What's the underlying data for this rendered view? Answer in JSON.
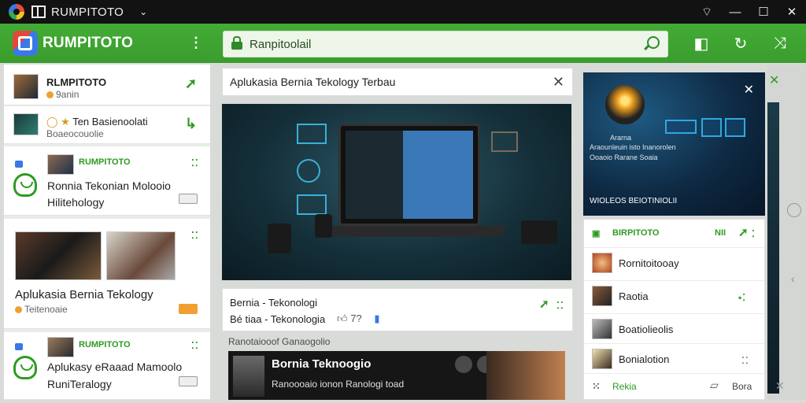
{
  "window": {
    "title": "RUMPITOTO",
    "chevron": "⌄",
    "controls": [
      "⌔",
      "—",
      "☐",
      "✕"
    ]
  },
  "appbar": {
    "brand": "RUMPITOTO",
    "search_text": "Ranpitoolail",
    "icons": [
      "tag-icon",
      "refresh-icon",
      "share-icon"
    ]
  },
  "left": {
    "row1": {
      "title": "RLMPITOTO",
      "sub": "9anin"
    },
    "row2": {
      "title": "Ten Basienoolati",
      "sub": "Boaeocouolie"
    },
    "row3": {
      "author": "RUMPITOTO",
      "line1": "Ronnia Tekonian Molooio",
      "line2": "Hilitehology"
    },
    "row4": {
      "caption": "Aplukasia Bernia Tekology",
      "sub": "Teitenoaie"
    },
    "row5": {
      "author": "RUMPITOTO",
      "line1": "Aplukasy eRaaad Mamoolo",
      "line2": "RuniTeralogy"
    }
  },
  "center": {
    "header": "Aplukasia Bernia Tekology Terbau",
    "post_title": "Bernia - Tekonologi",
    "post_sub": "Bé tiaa - Tekonologia",
    "post_likes": "7?",
    "section_label": "Ranotaiooof Ganaogolio",
    "video_title": "Bornia Teknoogio",
    "video_sub": "Ranoooaio ionon Ranologi toad"
  },
  "right": {
    "promo_title": "Ararna",
    "promo_line1": "Araounleuin isto Inanorolen",
    "promo_line2": "Ooaoio Rarane Soaia",
    "promo_bottom": "WIOLEOS BEIOTINIOLII",
    "header_name": "BIRPITOTO",
    "header_code": "NII",
    "items": [
      "Rornitoitooay",
      "Raotia",
      "Boatiolieolis",
      "Bonialotion"
    ],
    "footer_left": "Rekia",
    "footer_right": "Bora"
  }
}
